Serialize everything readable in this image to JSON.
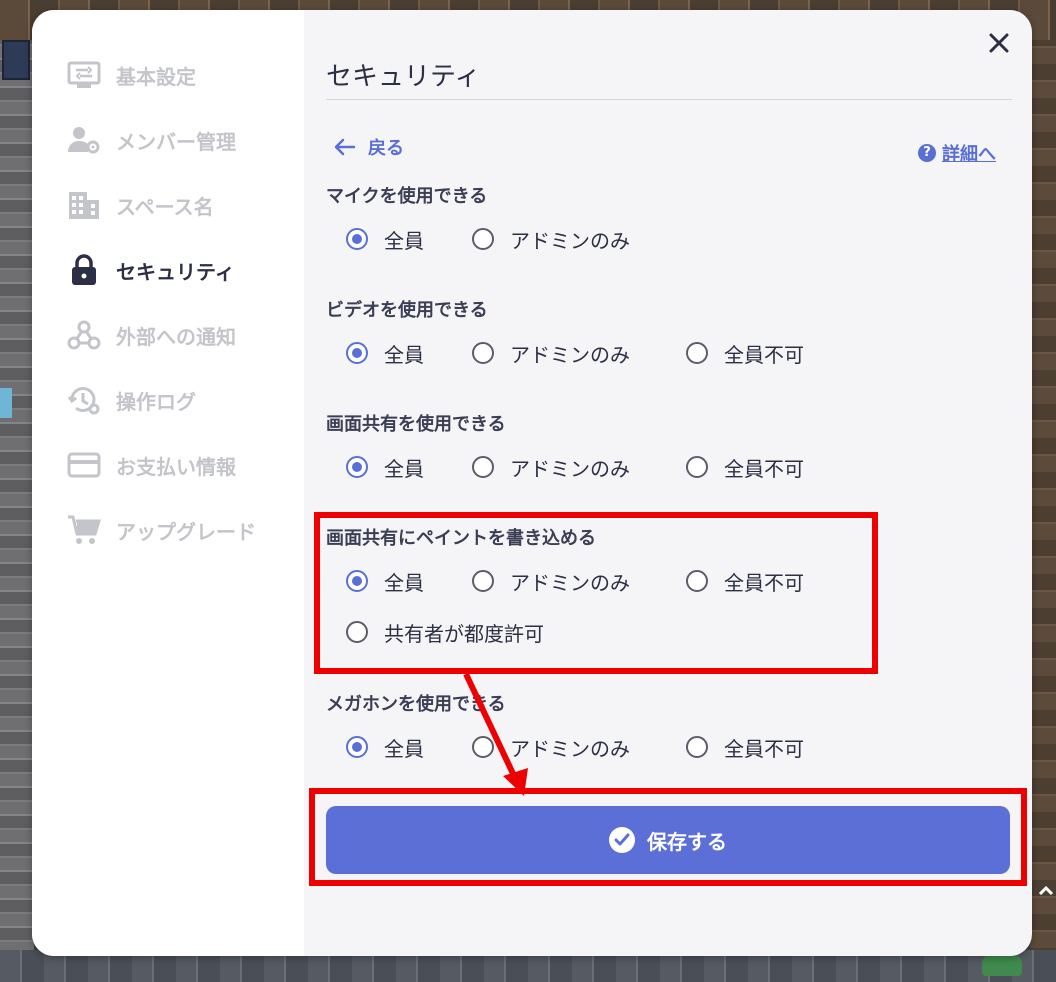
{
  "sidebar": {
    "items": [
      {
        "label": "基本設定",
        "icon": "settings-panel-icon",
        "active": false
      },
      {
        "label": "メンバー管理",
        "icon": "member-settings-icon",
        "active": false
      },
      {
        "label": "スペース名",
        "icon": "building-icon",
        "active": false
      },
      {
        "label": "セキュリティ",
        "icon": "lock-icon",
        "active": true
      },
      {
        "label": "外部への通知",
        "icon": "webhook-icon",
        "active": false
      },
      {
        "label": "操作ログ",
        "icon": "history-settings-icon",
        "active": false
      },
      {
        "label": "お支払い情報",
        "icon": "credit-card-icon",
        "active": false
      },
      {
        "label": "アップグレード",
        "icon": "cart-icon",
        "active": false
      }
    ]
  },
  "header": {
    "title": "セキュリティ",
    "back_label": "戻る",
    "help_label": "詳細へ",
    "help_icon_glyph": "?"
  },
  "settings": [
    {
      "label": "マイクを使用できる",
      "options": [
        "全員",
        "アドミンのみ"
      ],
      "selected": 0
    },
    {
      "label": "ビデオを使用できる",
      "options": [
        "全員",
        "アドミンのみ",
        "全員不可"
      ],
      "selected": 0
    },
    {
      "label": "画面共有を使用できる",
      "options": [
        "全員",
        "アドミンのみ",
        "全員不可"
      ],
      "selected": 0
    },
    {
      "label": "画面共有にペイントを書き込める",
      "options": [
        "全員",
        "アドミンのみ",
        "全員不可",
        "共有者が都度許可"
      ],
      "selected": 0
    },
    {
      "label": "メガホンを使用できる",
      "options": [
        "全員",
        "アドミンのみ",
        "全員不可"
      ],
      "selected": 0
    }
  ],
  "save_button": {
    "label": "保存する"
  },
  "colors": {
    "accent": "#5b6fd6",
    "highlight": "#ee0000",
    "text_dark": "#2c2f45",
    "text_muted": "#c4c5cb"
  }
}
